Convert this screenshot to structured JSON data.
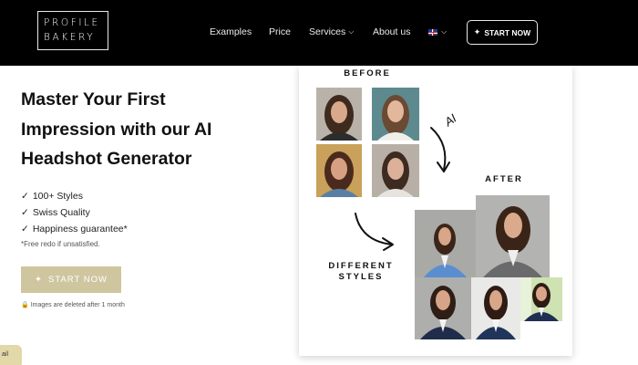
{
  "header": {
    "logo_line1": "PROFILE",
    "logo_line2": "BAKERY",
    "nav": {
      "examples": "Examples",
      "price": "Price",
      "services": "Services",
      "about": "About us"
    },
    "language_icon": "uk-flag-icon",
    "start_button": "START NOW"
  },
  "hero": {
    "title": "Master Your First Impression with our AI Headshot Generator",
    "features": [
      "100+ Styles",
      "Swiss Quality",
      "Happiness guarantee*"
    ],
    "check_glyph": "✓",
    "footnote": "*Free redo if unsatisfied.",
    "start_button": "START NOW",
    "privacy_note": "Images are deleted after 1 month",
    "corner_tab": "ail"
  },
  "showcase": {
    "before_label": "BEFORE",
    "ai_label": "AI",
    "after_label": "AFTER",
    "styles_label_line1": "DIFFERENT",
    "styles_label_line2": "STYLES"
  },
  "colors": {
    "navbar": "#000000",
    "accent_button": "#cfc6a0",
    "corner_tab": "#e2d8a8"
  }
}
